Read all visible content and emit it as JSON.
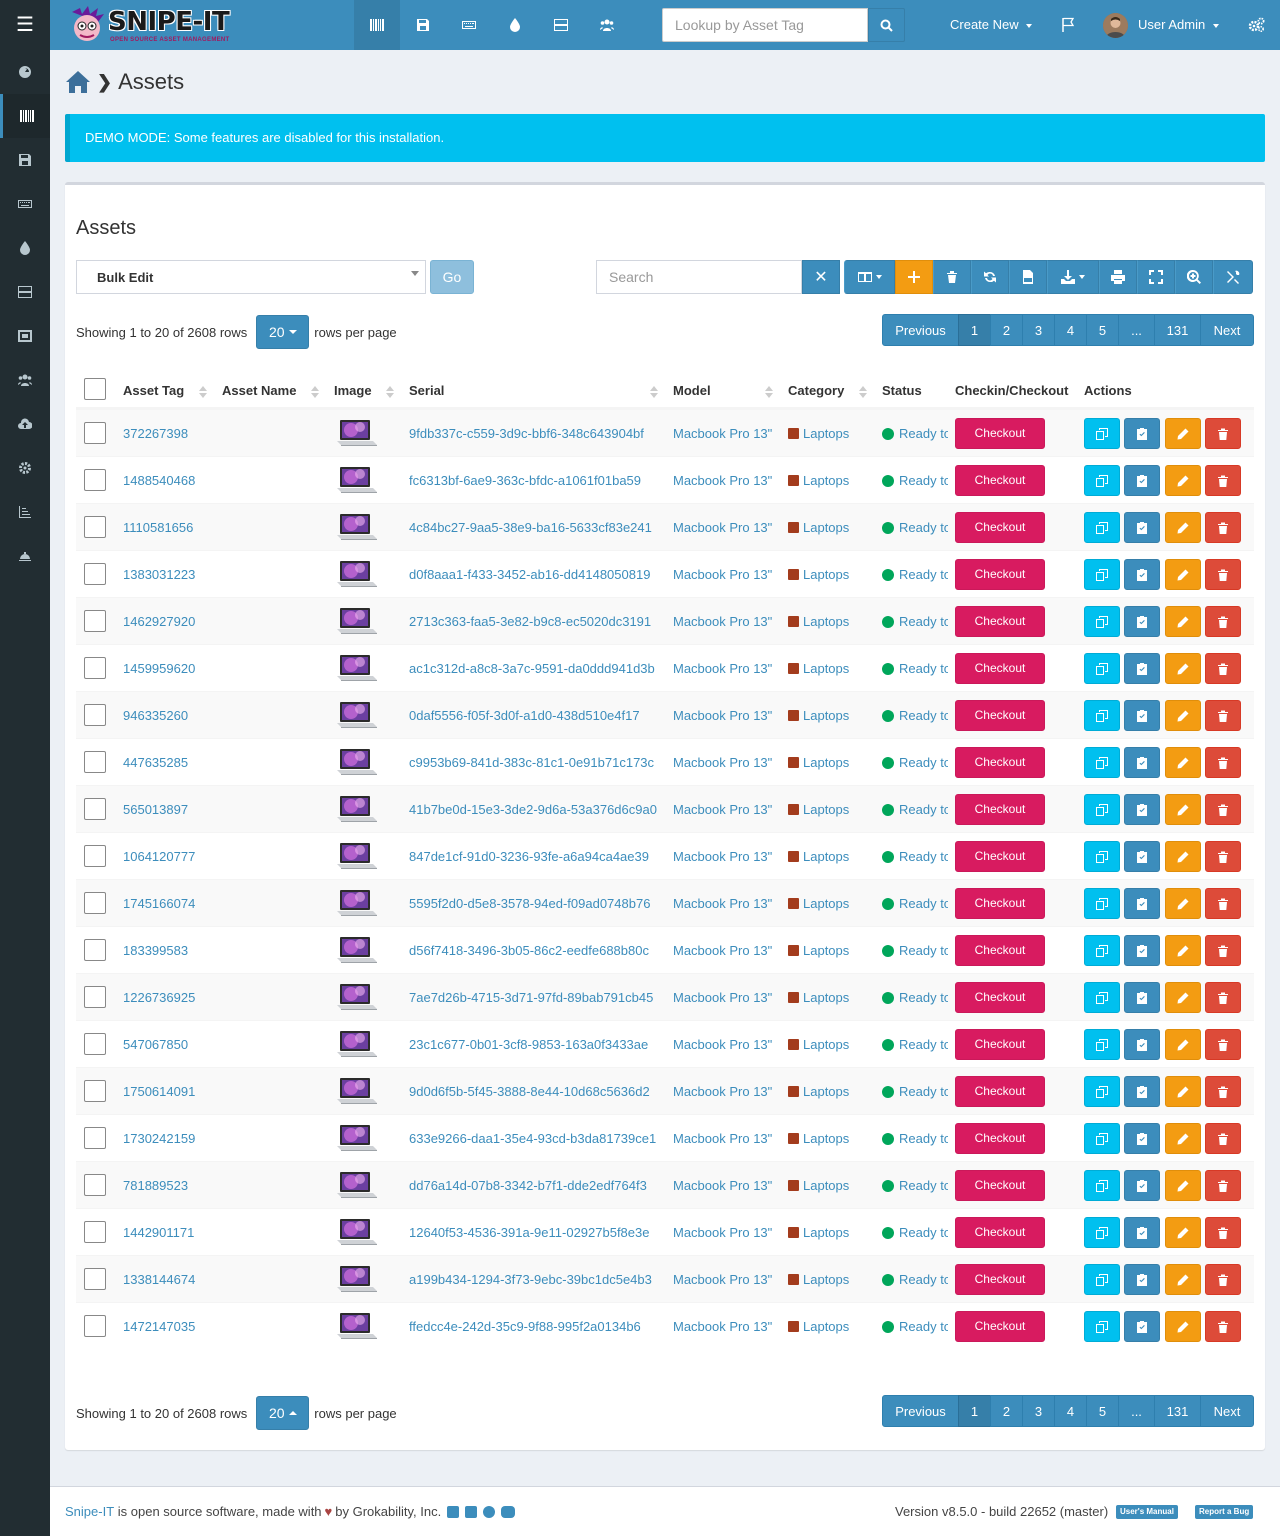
{
  "app": {
    "logo_text": "SNIPE-IT",
    "logo_subtitle": "OPEN SOURCE ASSET MANAGEMENT"
  },
  "topbar": {
    "lookup_placeholder": "Lookup by Asset Tag",
    "create_new": "Create New",
    "user_name": "User Admin",
    "nav_icons": [
      "barcode-icon",
      "save-icon",
      "keyboard-icon",
      "tint-icon",
      "server-icon",
      "users-icon"
    ]
  },
  "sidebar": {
    "items": [
      "dashboard-icon",
      "barcode-icon",
      "save-icon",
      "keyboard-icon",
      "tint-icon",
      "server-icon",
      "kit-icon",
      "users-icon",
      "cloud-upload-icon",
      "cog-icon",
      "reports-icon",
      "requestable-icon"
    ]
  },
  "breadcrumb": {
    "title": "Assets"
  },
  "alert": {
    "text": "DEMO MODE: Some features are disabled for this installation."
  },
  "box": {
    "title": "Assets",
    "bulk_edit": "Bulk Edit",
    "go": "Go",
    "search_placeholder": "Search"
  },
  "pagination": {
    "showing": "Showing 1 to 20 of 2608 rows",
    "per_page": "20",
    "rows_per_page": "rows per page",
    "previous": "Previous",
    "pages": [
      "1",
      "2",
      "3",
      "4",
      "5",
      "...",
      "131"
    ],
    "next": "Next",
    "active_page": "1"
  },
  "table": {
    "columns": {
      "asset_tag": "Asset Tag",
      "asset_name": "Asset Name",
      "image": "Image",
      "serial": "Serial",
      "model": "Model",
      "category": "Category",
      "status": "Status",
      "checkin_checkout": "Checkin/Checkout",
      "actions": "Actions"
    },
    "rows": [
      {
        "tag": "372267398",
        "serial": "9fdb337c-c559-3d9c-bbf6-348c643904bf",
        "model": "Macbook Pro 13\"",
        "category": "Laptops",
        "status": "Ready to Deploy",
        "checkout": "Checkout"
      },
      {
        "tag": "1488540468",
        "serial": "fc6313bf-6ae9-363c-bfdc-a1061f01ba59",
        "model": "Macbook Pro 13\"",
        "category": "Laptops",
        "status": "Ready to Deploy",
        "checkout": "Checkout"
      },
      {
        "tag": "1110581656",
        "serial": "4c84bc27-9aa5-38e9-ba16-5633cf83e241",
        "model": "Macbook Pro 13\"",
        "category": "Laptops",
        "status": "Ready to Deploy",
        "checkout": "Checkout"
      },
      {
        "tag": "1383031223",
        "serial": "d0f8aaa1-f433-3452-ab16-dd4148050819",
        "model": "Macbook Pro 13\"",
        "category": "Laptops",
        "status": "Ready to Deploy",
        "checkout": "Checkout"
      },
      {
        "tag": "1462927920",
        "serial": "2713c363-faa5-3e82-b9c8-ec5020dc3191",
        "model": "Macbook Pro 13\"",
        "category": "Laptops",
        "status": "Ready to Deploy",
        "checkout": "Checkout"
      },
      {
        "tag": "1459959620",
        "serial": "ac1c312d-a8c8-3a7c-9591-da0ddd941d3b",
        "model": "Macbook Pro 13\"",
        "category": "Laptops",
        "status": "Ready to Deploy",
        "checkout": "Checkout"
      },
      {
        "tag": "946335260",
        "serial": "0daf5556-f05f-3d0f-a1d0-438d510e4f17",
        "model": "Macbook Pro 13\"",
        "category": "Laptops",
        "status": "Ready to Deploy",
        "checkout": "Checkout"
      },
      {
        "tag": "447635285",
        "serial": "c9953b69-841d-383c-81c1-0e91b71c173c",
        "model": "Macbook Pro 13\"",
        "category": "Laptops",
        "status": "Ready to Deploy",
        "checkout": "Checkout"
      },
      {
        "tag": "565013897",
        "serial": "41b7be0d-15e3-3de2-9d6a-53a376d6c9a0",
        "model": "Macbook Pro 13\"",
        "category": "Laptops",
        "status": "Ready to Deploy",
        "checkout": "Checkout"
      },
      {
        "tag": "1064120777",
        "serial": "847de1cf-91d0-3236-93fe-a6a94ca4ae39",
        "model": "Macbook Pro 13\"",
        "category": "Laptops",
        "status": "Ready to Deploy",
        "checkout": "Checkout"
      },
      {
        "tag": "1745166074",
        "serial": "5595f2d0-d5e8-3578-94ed-f09ad0748b76",
        "model": "Macbook Pro 13\"",
        "category": "Laptops",
        "status": "Ready to Deploy",
        "checkout": "Checkout"
      },
      {
        "tag": "183399583",
        "serial": "d56f7418-3496-3b05-86c2-eedfe688b80c",
        "model": "Macbook Pro 13\"",
        "category": "Laptops",
        "status": "Ready to Deploy",
        "checkout": "Checkout"
      },
      {
        "tag": "1226736925",
        "serial": "7ae7d26b-4715-3d71-97fd-89bab791cb45",
        "model": "Macbook Pro 13\"",
        "category": "Laptops",
        "status": "Ready to Deploy",
        "checkout": "Checkout"
      },
      {
        "tag": "547067850",
        "serial": "23c1c677-0b01-3cf8-9853-163a0f3433ae",
        "model": "Macbook Pro 13\"",
        "category": "Laptops",
        "status": "Ready to Deploy",
        "checkout": "Checkout"
      },
      {
        "tag": "1750614091",
        "serial": "9d0d6f5b-5f45-3888-8e44-10d68c5636d2",
        "model": "Macbook Pro 13\"",
        "category": "Laptops",
        "status": "Ready to Deploy",
        "checkout": "Checkout"
      },
      {
        "tag": "1730242159",
        "serial": "633e9266-daa1-35e4-93cd-b3da81739ce1",
        "model": "Macbook Pro 13\"",
        "category": "Laptops",
        "status": "Ready to Deploy",
        "checkout": "Checkout"
      },
      {
        "tag": "781889523",
        "serial": "dd76a14d-07b8-3342-b7f1-dde2edf764f3",
        "model": "Macbook Pro 13\"",
        "category": "Laptops",
        "status": "Ready to Deploy",
        "checkout": "Checkout"
      },
      {
        "tag": "1442901171",
        "serial": "12640f53-4536-391a-9e11-02927b5f8e3e",
        "model": "Macbook Pro 13\"",
        "category": "Laptops",
        "status": "Ready to Deploy",
        "checkout": "Checkout"
      },
      {
        "tag": "1338144674",
        "serial": "a199b434-1294-3f73-9ebc-39bc1dc5e4b3",
        "model": "Macbook Pro 13\"",
        "category": "Laptops",
        "status": "Ready to Deploy",
        "checkout": "Checkout"
      },
      {
        "tag": "1472147035",
        "serial": "ffedcc4e-242d-35c9-9f88-995f2a0134b6",
        "model": "Macbook Pro 13\"",
        "category": "Laptops",
        "status": "Ready to Deploy",
        "checkout": "Checkout"
      }
    ]
  },
  "footer": {
    "link": "Snipe-IT",
    "text_before": "is open source software, made with",
    "text_after": "by Grokability, Inc.",
    "version": "Version v8.5.0 - build 22652 (master)",
    "manual": "User's Manual",
    "report_bug": "Report a Bug"
  },
  "colors": {
    "navbar": "#3c8dbc",
    "sidebar": "#222d32",
    "checkout": "#d81b60",
    "status_ready": "#00a65a",
    "category": "#a33c1d",
    "alert": "#00c0ef"
  }
}
